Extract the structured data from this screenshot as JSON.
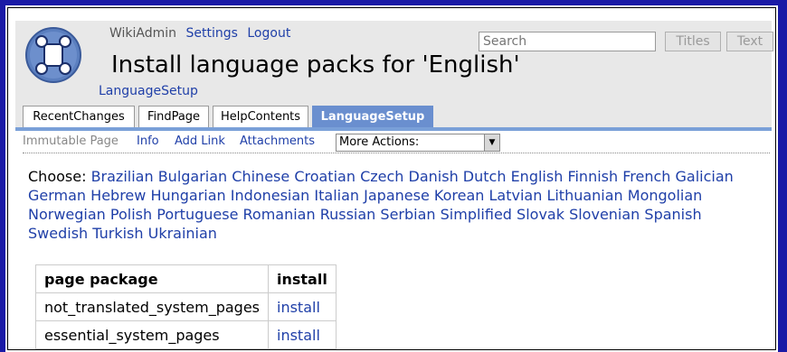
{
  "user": {
    "name": "WikiAdmin",
    "settings": "Settings",
    "logout": "Logout"
  },
  "search": {
    "placeholder": "Search",
    "titles_btn": "Titles",
    "text_btn": "Text"
  },
  "page": {
    "title": "Install language packs for 'English'",
    "breadcrumb": "LanguageSetup"
  },
  "tabs": [
    "RecentChanges",
    "FindPage",
    "HelpContents",
    "LanguageSetup"
  ],
  "actions": {
    "immutable": "Immutable Page",
    "info": "Info",
    "add_link": "Add Link",
    "attachments": "Attachments",
    "more_actions": "More Actions:"
  },
  "choose": {
    "label": "Choose:",
    "languages": [
      "Brazilian",
      "Bulgarian",
      "Chinese",
      "Croatian",
      "Czech",
      "Danish",
      "Dutch",
      "English",
      "Finnish",
      "French",
      "Galician",
      "German",
      "Hebrew",
      "Hungarian",
      "Indonesian",
      "Italian",
      "Japanese",
      "Korean",
      "Latvian",
      "Lithuanian",
      "Mongolian",
      "Norwegian",
      "Polish",
      "Portuguese",
      "Romanian",
      "Russian",
      "Serbian",
      "Simplified",
      "Slovak",
      "Slovenian",
      "Spanish",
      "Swedish",
      "Turkish",
      "Ukrainian"
    ]
  },
  "table": {
    "headers": [
      "page package",
      "install"
    ],
    "rows": [
      [
        "not_translated_system_pages",
        "install"
      ],
      [
        "essential_system_pages",
        "install"
      ]
    ]
  },
  "colors": {
    "link": "#1f3fa8",
    "active_tab": "#6a8fcf",
    "border": "#1a1aa6"
  }
}
